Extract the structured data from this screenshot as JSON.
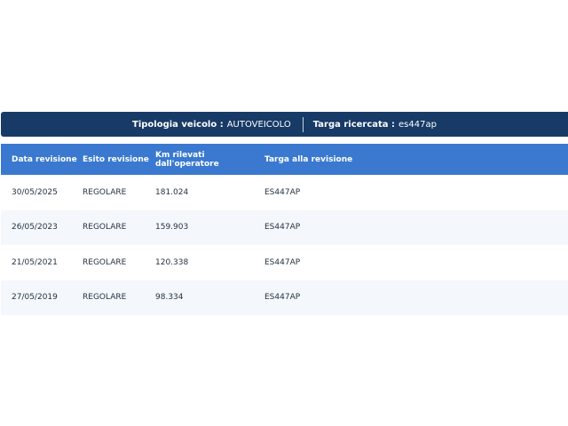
{
  "info_bar": {
    "vehicle_type_label": "Tipologia veicolo :",
    "vehicle_type_value": "AUTOVEICOLO",
    "plate_label": "Targa ricercata :",
    "plate_value": "es447ap"
  },
  "table": {
    "headers": [
      "Data revisione",
      "Esito revisione",
      "Km rilevati dall'operatore",
      "Targa alla revisione"
    ],
    "rows": [
      [
        "30/05/2025",
        "REGOLARE",
        "181.024",
        "ES447AP"
      ],
      [
        "26/05/2023",
        "REGOLARE",
        "159.903",
        "ES447AP"
      ],
      [
        "21/05/2021",
        "REGOLARE",
        "120.338",
        "ES447AP"
      ],
      [
        "27/05/2019",
        "REGOLARE",
        "98.334",
        "ES447AP"
      ]
    ]
  },
  "colors": {
    "info_bar_bg": "#173a67",
    "header_bg": "#3a79cf",
    "stripe_bg": "#f4f8fc"
  }
}
